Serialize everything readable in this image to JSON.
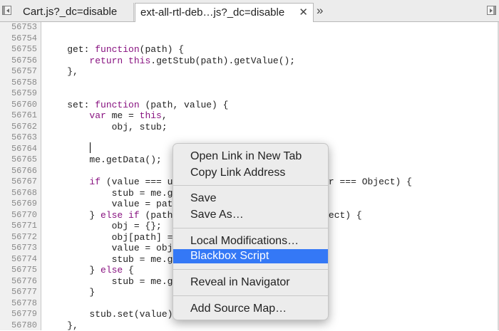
{
  "tabs": {
    "tab1_label": "Cart.js?_dc=disable",
    "tab2_label": "ext-all-rtl-deb…js?_dc=disable",
    "close_glyph": "✕",
    "more_glyph": "»"
  },
  "lines": [
    {
      "n": "56753",
      "t": ""
    },
    {
      "n": "56754",
      "t": ""
    },
    {
      "n": "56755",
      "t": "    get: function(path) {"
    },
    {
      "n": "56756",
      "t": "        return this.getStub(path).getValue();"
    },
    {
      "n": "56757",
      "t": "    },"
    },
    {
      "n": "56758",
      "t": ""
    },
    {
      "n": "56759",
      "t": ""
    },
    {
      "n": "56760",
      "t": "    set: function (path, value) {"
    },
    {
      "n": "56761",
      "t": "        var me = this,"
    },
    {
      "n": "56762",
      "t": "            obj, stub;"
    },
    {
      "n": "56763",
      "t": ""
    },
    {
      "n": "56764",
      "t": ""
    },
    {
      "n": "56765",
      "t": "        me.getData();"
    },
    {
      "n": "56766",
      "t": ""
    },
    {
      "n": "56767",
      "t": "        if (value === undefined || value.constructor === Object) {"
    },
    {
      "n": "56768",
      "t": "            stub = me.getStub(path);"
    },
    {
      "n": "56769",
      "t": "            value = path;"
    },
    {
      "n": "56770",
      "t": "        } else if (path && path.constructor === Object) {"
    },
    {
      "n": "56771",
      "t": "            obj = {};"
    },
    {
      "n": "56772",
      "t": "            obj[path] = value;"
    },
    {
      "n": "56773",
      "t": "            value = obj;"
    },
    {
      "n": "56774",
      "t": "            stub = me.getRoot();"
    },
    {
      "n": "56775",
      "t": "        } else {"
    },
    {
      "n": "56776",
      "t": "            stub = me.getRoot();"
    },
    {
      "n": "56777",
      "t": "        }"
    },
    {
      "n": "56778",
      "t": ""
    },
    {
      "n": "56779",
      "t": "        stub.set(value);"
    },
    {
      "n": "56780",
      "t": "    },"
    }
  ],
  "menu": {
    "open_link": "Open Link in New Tab",
    "copy_link": "Copy Link Address",
    "save": "Save",
    "save_as": "Save As…",
    "local_mods": "Local Modifications…",
    "blackbox": "Blackbox Script",
    "reveal": "Reveal in Navigator",
    "add_source_map": "Add Source Map…"
  },
  "colors": {
    "selection": "#3478f6",
    "keyword": "#881280"
  }
}
